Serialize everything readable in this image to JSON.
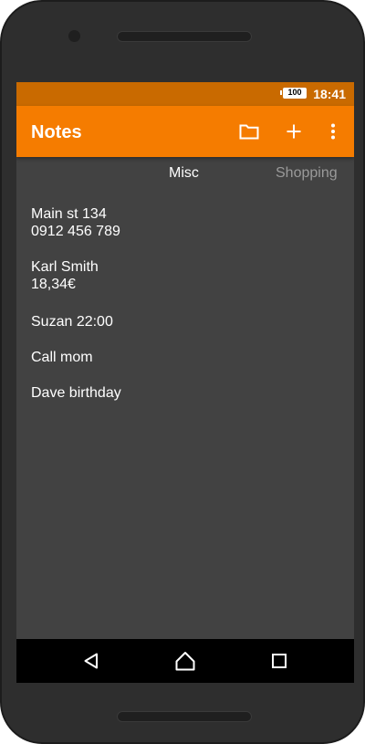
{
  "status_bar": {
    "battery": "100",
    "time": "18:41"
  },
  "app_bar": {
    "title": "Notes",
    "actions": [
      {
        "icon": "folder-icon"
      },
      {
        "icon": "add-icon"
      },
      {
        "icon": "more-vert-icon"
      }
    ]
  },
  "tabs": [
    {
      "label": "Misc",
      "active": true
    },
    {
      "label": "Shopping",
      "active": false
    }
  ],
  "notes": [
    {
      "text": "Main st 134\n0912 456 789"
    },
    {
      "text": "Karl Smith\n18,34€"
    },
    {
      "text": "Suzan 22:00"
    },
    {
      "text": "Call mom"
    },
    {
      "text": "Dave birthday"
    }
  ],
  "colors": {
    "primary": "#f57c00",
    "status_bar": "#c96a00",
    "background": "#424242",
    "inactive_tab": "#9a9a9a"
  }
}
